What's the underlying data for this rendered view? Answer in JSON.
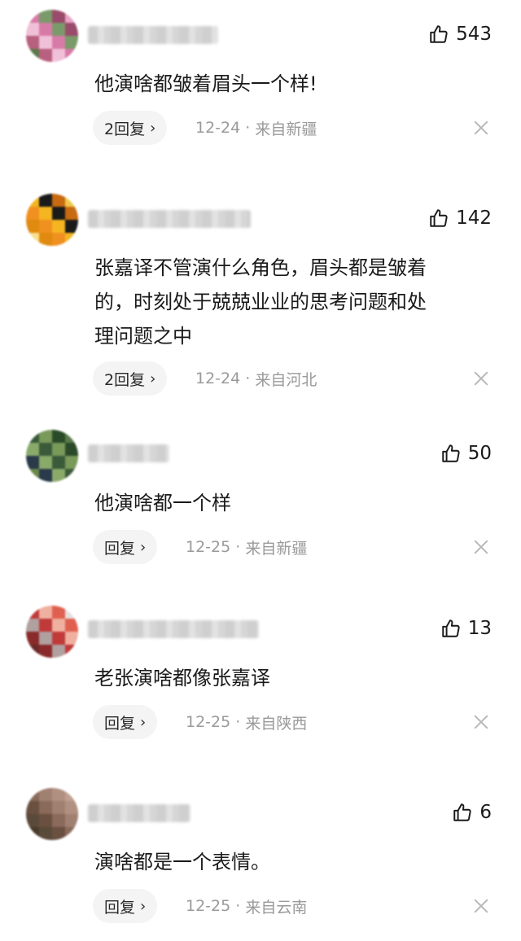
{
  "comments": [
    {
      "likes": "543",
      "text": "他演啥都皱着眉头一个样!",
      "reply_label": "2回复",
      "date": "12-24",
      "location": "来自新疆",
      "avatar_colors": [
        "#d87aa8",
        "#e9a5c6",
        "#b8607f",
        "#7a9a6a",
        "#c98aa6",
        "#f0c0d8",
        "#9a4a6a",
        "#5a7a4a"
      ]
    },
    {
      "likes": "142",
      "text_lines": [
        "张嘉译不管演什么角色，眉头都是皱着",
        "的，时刻处于兢兢业业的思考问题和处",
        "理问题之中"
      ],
      "reply_label": "2回复",
      "date": "12-24",
      "location": "来自河北",
      "avatar_colors": [
        "#f5b520",
        "#f0c94a",
        "#e08a10",
        "#1a1a1a",
        "#f5d070",
        "#f09020",
        "#c86a10",
        "#f8e090"
      ]
    },
    {
      "likes": "50",
      "text": "他演啥都一个样",
      "reply_label": "回复",
      "date": "12-25",
      "location": "来自新疆",
      "avatar_colors": [
        "#3a5a3a",
        "#5a7a4a",
        "#2a3a4a",
        "#7a9a5a",
        "#4a6a3a",
        "#8aaa6a",
        "#2a4a2a",
        "#6a8a4a"
      ]
    },
    {
      "likes": "13",
      "text": "老张演啥都像张嘉译",
      "reply_label": "回复",
      "date": "12-25",
      "location": "来自陕西",
      "avatar_colors": [
        "#c03a3a",
        "#e8e0e0",
        "#8a2a2a",
        "#f0b0a0",
        "#d05040",
        "#b0a0a0",
        "#e06050",
        "#6a2a2a"
      ]
    },
    {
      "likes": "6",
      "text": "演啥都是一个表情。",
      "reply_label": "回复",
      "date": "12-25",
      "location": "来自云南",
      "avatar_colors": [
        "#8a6a5a",
        "#c0a090",
        "#5a4a3a",
        "#a08070",
        "#d8c0b0",
        "#6a5040",
        "#b09080",
        "#4a3a2a"
      ]
    }
  ]
}
